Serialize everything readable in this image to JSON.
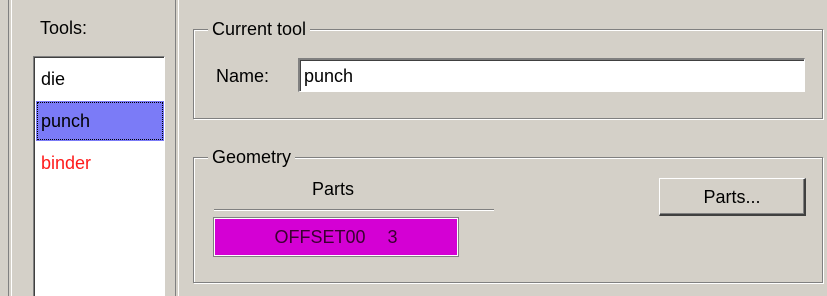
{
  "tools_panel": {
    "label": "Tools:",
    "items": [
      {
        "label": "die",
        "selected": false,
        "color": "#000000"
      },
      {
        "label": "punch",
        "selected": true,
        "color": "#000000"
      },
      {
        "label": "binder",
        "selected": false,
        "color": "#ff1a1a"
      }
    ]
  },
  "current_tool": {
    "legend": "Current tool",
    "name_label": "Name:",
    "name_value": "punch"
  },
  "geometry": {
    "legend": "Geometry",
    "parts_column_header": "Parts",
    "parts": [
      {
        "name": "OFFSET00",
        "count": "3",
        "color": "#d400d4"
      }
    ],
    "parts_button_label": "Parts..."
  },
  "colors": {
    "window_background": "#d4d0c8",
    "selection": "#7b7bf7",
    "part_highlight": "#d400d4"
  }
}
